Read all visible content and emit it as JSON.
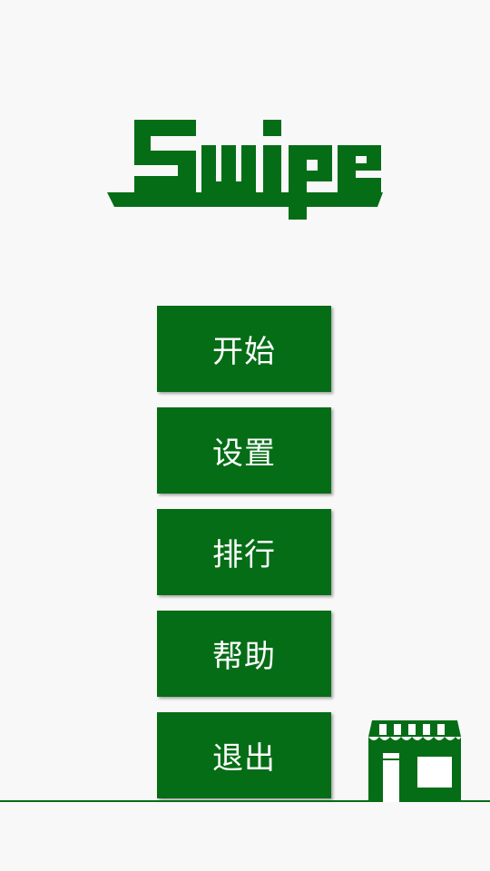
{
  "app": {
    "title": "Swipe"
  },
  "menu": {
    "items": [
      {
        "label": "开始",
        "name": "start-button"
      },
      {
        "label": "设置",
        "name": "settings-button"
      },
      {
        "label": "排行",
        "name": "leaderboard-button"
      },
      {
        "label": "帮助",
        "name": "help-button"
      },
      {
        "label": "退出",
        "name": "exit-button"
      }
    ]
  },
  "shop": {
    "icon": "shop-icon"
  },
  "colors": {
    "accent": "#056d16",
    "background": "#f8f8f8",
    "button_text": "#ffffff"
  }
}
